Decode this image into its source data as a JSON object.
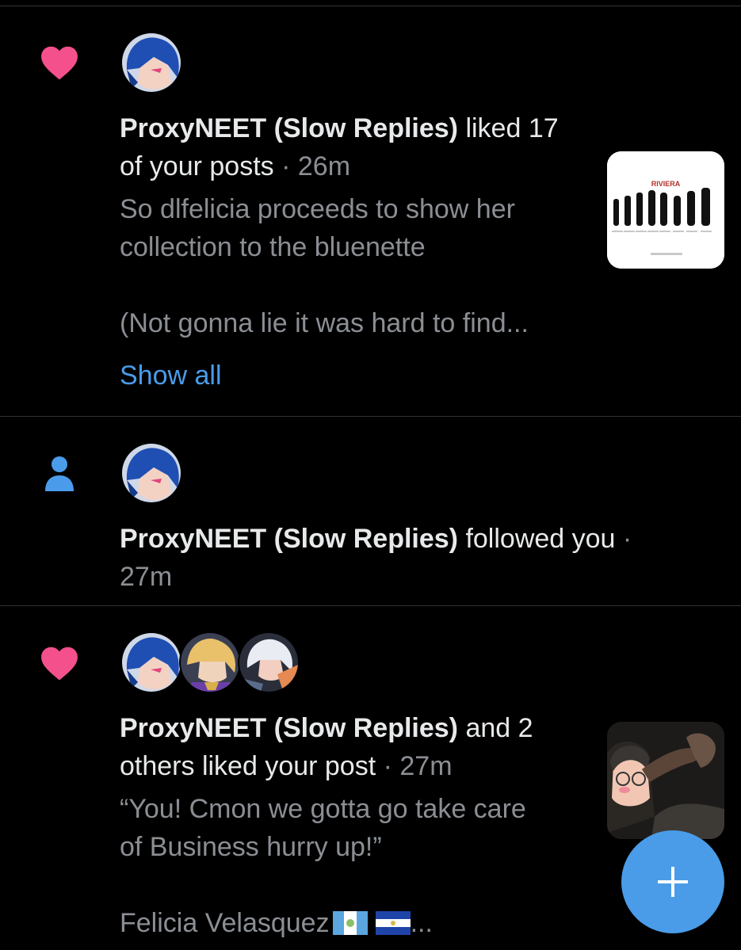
{
  "colors": {
    "background": "#000000",
    "like": "#f4508c",
    "follow": "#4a9cea",
    "link": "#4a9cea",
    "muted": "#8b8f94",
    "fab": "#4a9ce8"
  },
  "notifications": [
    {
      "icon": "heart-icon",
      "name": "ProxyNEET (Slow Replies)",
      "action": " liked 17 of your posts",
      "separator": " · ",
      "time": "26m",
      "snippet_line1": "So dlfelicia proceeds to show her",
      "snippet_line2": "collection to the bluenette",
      "snippet_line3": "(Not gonna lie it was hard to find...",
      "show_all": "Show all",
      "thumb_label": "RIVIERA"
    },
    {
      "icon": "person-icon",
      "name": "ProxyNEET (Slow Replies)",
      "action": " followed you",
      "separator": " · ",
      "time": "27m"
    },
    {
      "icon": "heart-icon",
      "name": "ProxyNEET (Slow Replies)",
      "action": " and 2 others liked your post",
      "separator": " · ",
      "time": "27m",
      "snippet_line1": "“You! Cmon we gotta go take care",
      "snippet_line2": "of Business hurry up!”",
      "snippet_line3": "Felicia Velasquez",
      "snippet_trail": " ..."
    }
  ],
  "fab": {
    "icon": "plus-icon",
    "label": "+"
  }
}
